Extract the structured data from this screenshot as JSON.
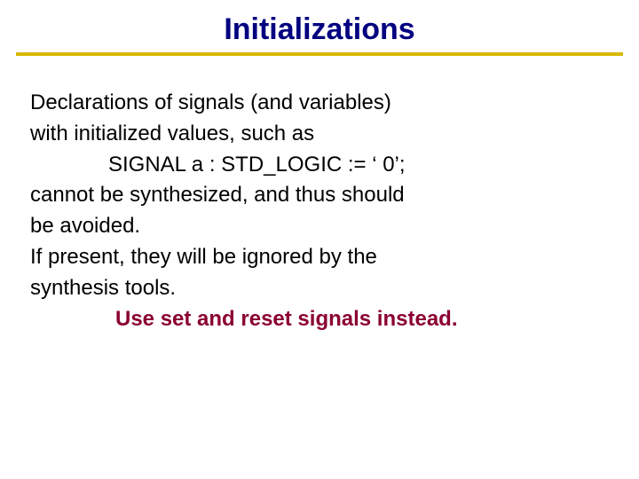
{
  "title": "Initializations",
  "body": {
    "l1": "Declarations of signals (and variables)",
    "l2": "with initialized values, such as",
    "l3": "SIGNAL  a : STD_LOGIC := ‘ 0’;",
    "l4": "cannot be synthesized, and thus should",
    "l5": "be avoided.",
    "l6": "If present, they will be ignored by the",
    "l7": "synthesis tools.",
    "l8": "Use set and reset signals instead."
  }
}
